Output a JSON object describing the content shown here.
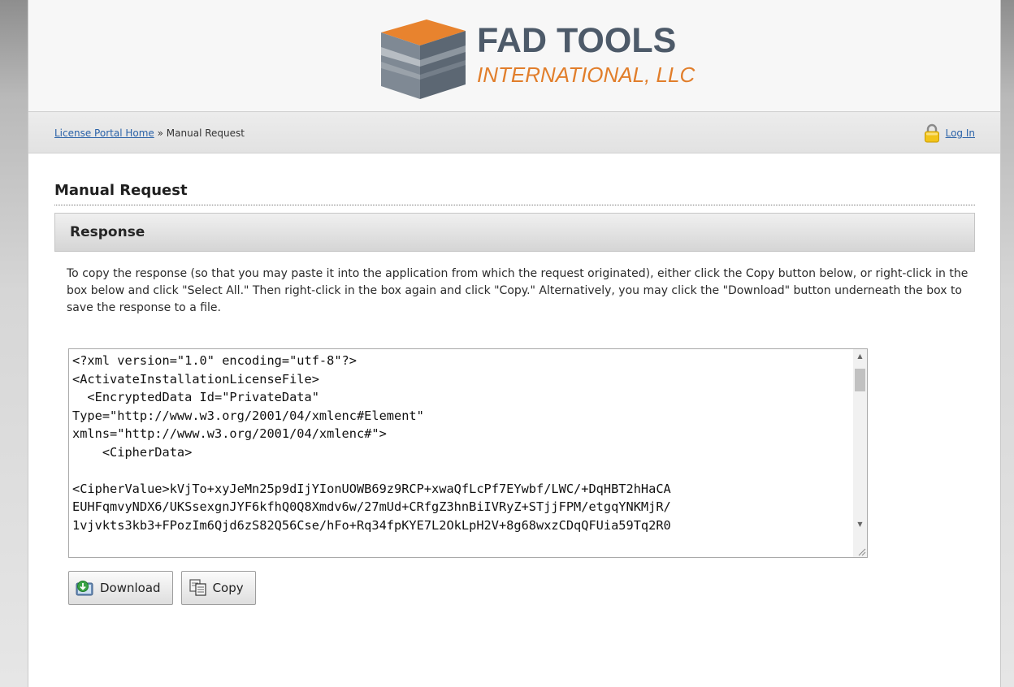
{
  "logo": {
    "line1": "FAD TOOLS",
    "line2": "INTERNATIONAL, LLC",
    "colors": {
      "orange": "#e17e2b",
      "slate": "#4d5a69"
    }
  },
  "breadcrumb": {
    "home_link": "License Portal Home",
    "separator": "»",
    "current": "Manual Request"
  },
  "login": {
    "label": "Log In",
    "icon": "lock-icon"
  },
  "page": {
    "heading": "Manual Request",
    "section_title": "Response",
    "instructions": "To copy the response (so that you may paste it into the application from which the request originated), either click the Copy button below, or right-click in the box below and click \"Select All.\" Then right-click in the box again and click \"Copy.\" Alternatively, you may click the \"Download\" button underneath the box to save the response to a file."
  },
  "response_box": {
    "value": "<?xml version=\"1.0\" encoding=\"utf-8\"?>\n<ActivateInstallationLicenseFile>\n  <EncryptedData Id=\"PrivateData\"\nType=\"http://www.w3.org/2001/04/xmlenc#Element\"\nxmlns=\"http://www.w3.org/2001/04/xmlenc#\">\n    <CipherData>\n\n<CipherValue>kVjTo+xyJeMn25p9dIjYIonUOWB69z9RCP+xwaQfLcPf7EYwbf/LWC/+DqHBT2hHaCA\nEUHFqmvyNDX6/UKSsexgnJYF6kfhQ0Q8Xmdv6w/27mUd+CRfgZ3hnBiIVRyZ+STjjFPM/etgqYNKMjR/\n1vjvkts3kb3+FPozIm6Qjd6zS82Q56Cse/hFo+Rq34fpKYE7L2OkLpH2V+8g68wxzCDqQFUia59Tq2R0"
  },
  "buttons": {
    "download": {
      "label": "Download",
      "icon": "download-icon"
    },
    "copy": {
      "label": "Copy",
      "icon": "copy-icon"
    }
  }
}
